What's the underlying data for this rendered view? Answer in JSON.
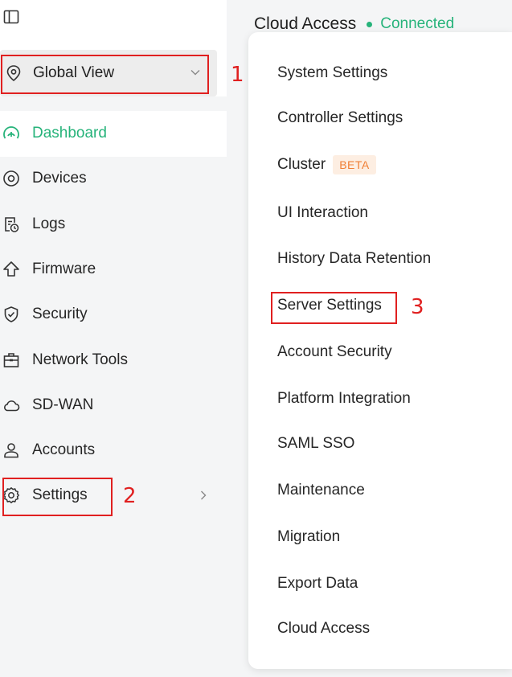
{
  "sidebar": {
    "site_selector": {
      "label": "Global View",
      "icon": "location-pin-icon"
    },
    "nav": [
      {
        "label": "Dashboard",
        "icon": "dashboard-gauge-icon",
        "active": true
      },
      {
        "label": "Devices",
        "icon": "devices-icon"
      },
      {
        "label": "Logs",
        "icon": "logs-icon"
      },
      {
        "label": "Firmware",
        "icon": "firmware-upload-icon"
      },
      {
        "label": "Security",
        "icon": "shield-check-icon"
      },
      {
        "label": "Network Tools",
        "icon": "toolbox-icon"
      },
      {
        "label": "SD-WAN",
        "icon": "cloud-icon"
      },
      {
        "label": "Accounts",
        "icon": "user-icon"
      },
      {
        "label": "Settings",
        "icon": "gear-icon"
      }
    ]
  },
  "header": {
    "title": "Cloud Access",
    "status": "Connected"
  },
  "menu": {
    "items": [
      "System Settings",
      "Controller Settings",
      "Cluster",
      "UI Interaction",
      "History Data Retention",
      "Server Settings",
      "Account Security",
      "Platform Integration",
      "SAML SSO",
      "Maintenance",
      "Migration",
      "Export Data",
      "Cloud Access"
    ],
    "cluster_badge": "BETA"
  },
  "annotations": {
    "step1": "1",
    "step2": "2",
    "step3": "3"
  },
  "colors": {
    "accent": "#26b37a",
    "callout": "#e02020",
    "beta_text": "#f07f36",
    "beta_bg": "#fdeee2"
  }
}
